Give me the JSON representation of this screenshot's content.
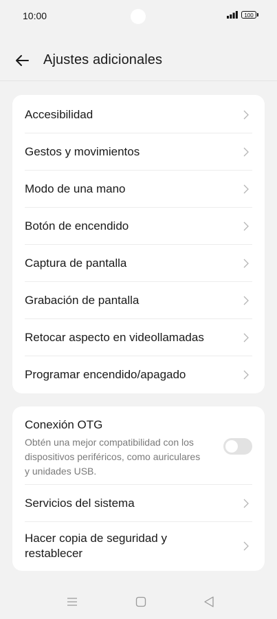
{
  "status_bar": {
    "time": "10:00",
    "battery": "100",
    "icons": [
      "signal-icon",
      "battery-icon"
    ]
  },
  "header": {
    "title": "Ajustes adicionales",
    "back_icon": "arrow-left-icon"
  },
  "menu_group_1": [
    {
      "label": "Accesibilidad"
    },
    {
      "label": "Gestos y movimientos"
    },
    {
      "label": "Modo de una mano"
    },
    {
      "label": "Botón de encendido"
    },
    {
      "label": "Captura de pantalla"
    },
    {
      "label": "Grabación de pantalla"
    },
    {
      "label": "Retocar aspecto en videollamadas"
    },
    {
      "label": "Programar encendido/apagado"
    }
  ],
  "otg": {
    "title": "Conexión OTG",
    "description": "Obtén una mejor compatibilidad con los dispositivos periféricos, como auriculares y unidades USB.",
    "enabled": false
  },
  "menu_group_2": [
    {
      "label": "Servicios del sistema"
    },
    {
      "label": "Hacer copia de seguridad y restablecer"
    }
  ],
  "nav_bar": {
    "icons": [
      "menu-icon",
      "home-icon",
      "back-triangle-icon"
    ]
  },
  "colors": {
    "background": "#f2f2f2",
    "card": "#ffffff",
    "secondary_text": "#7a7a7a",
    "toggle_off": "#e2e2e2"
  }
}
